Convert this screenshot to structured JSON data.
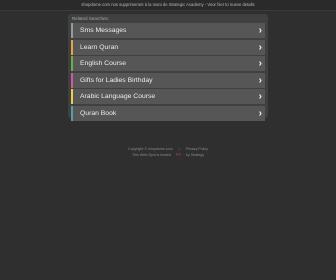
{
  "banner": {
    "text": "shopdome.com nos supprimeront à la mani de Strategic Academy - Voor hier to nueve details"
  },
  "panel": {
    "header": "Related Searches:"
  },
  "colors": {
    "page_bg": "#2f2f2f",
    "panel_bg": "#404040",
    "item_bg": "#565656",
    "accents": [
      "#8e9e9e",
      "#e8a24a",
      "#6ab04a",
      "#c95b9e",
      "#e6d24a",
      "#5a9ea0"
    ]
  },
  "items": [
    {
      "label": "Sms Messages",
      "icon": "chevron-right-icon"
    },
    {
      "label": "Learn Quran",
      "icon": "chevron-right-icon"
    },
    {
      "label": "English Course",
      "icon": "chevron-right-icon"
    },
    {
      "label": "Gifts for Ladies Birthday",
      "icon": "chevron-right-icon"
    },
    {
      "label": "Arabic Language Course",
      "icon": "chevron-right-icon"
    },
    {
      "label": "Quran Book",
      "icon": "chevron-right-icon"
    }
  ],
  "footer": {
    "copyright": "Copyright © shopdome.com",
    "privacy": "Privacy Policy",
    "line2_prefix": "This Web-Spot is hosted",
    "pp_label": "PP",
    "line2_suffix": "by Strategy"
  }
}
